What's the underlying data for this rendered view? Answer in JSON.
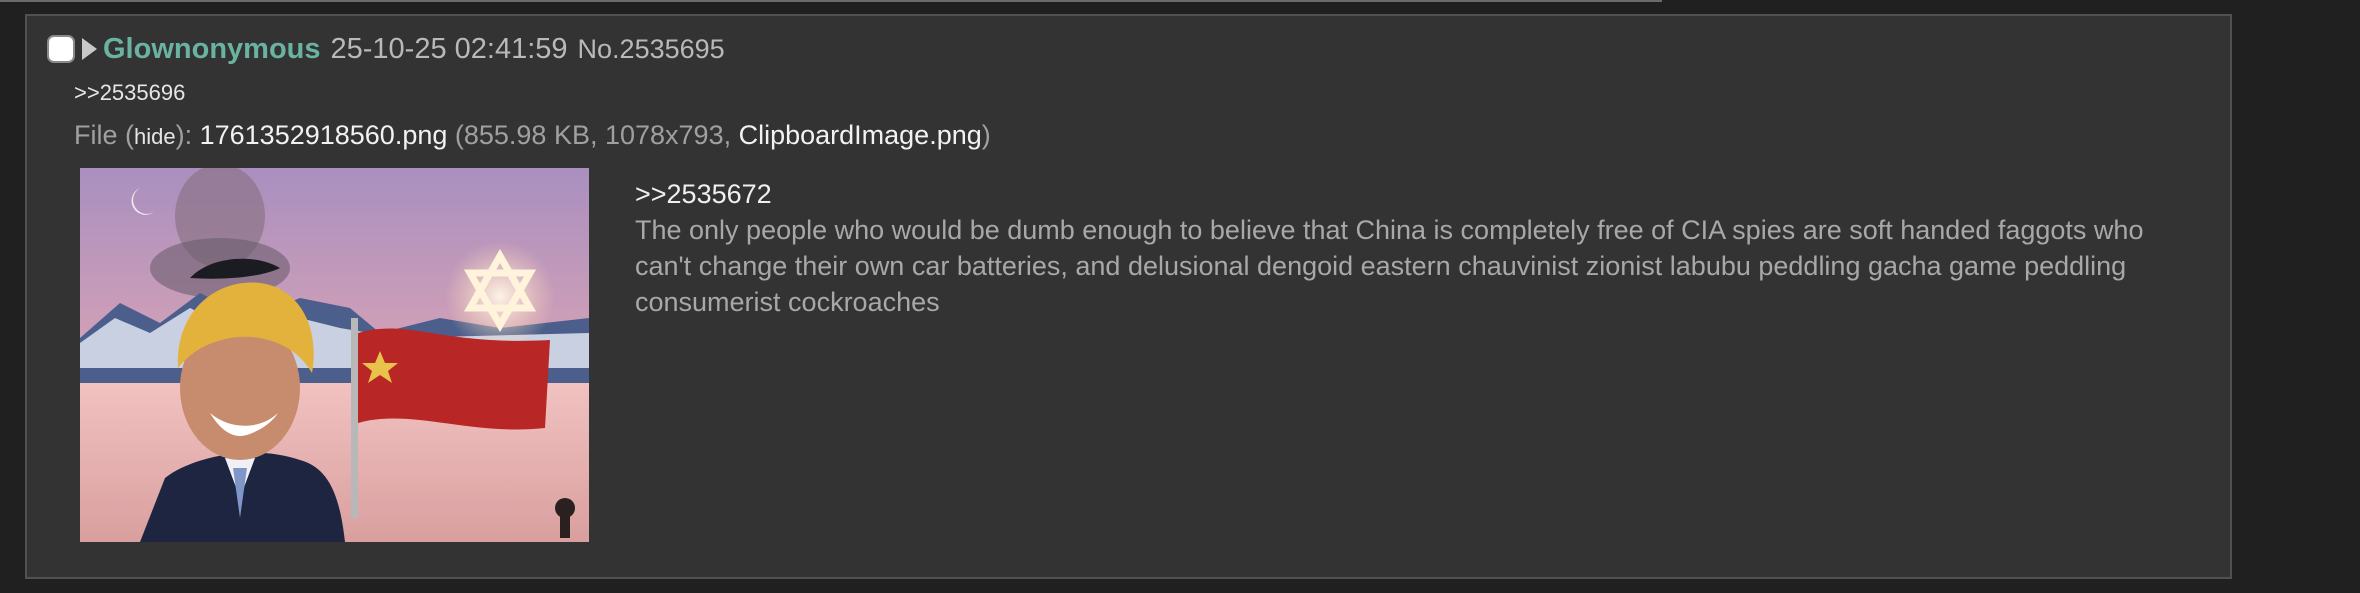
{
  "post": {
    "poster_name": "Glownonymous",
    "date": "25-10-25 02:41:59",
    "number": "No.2535695",
    "backlink": ">>2535696",
    "file": {
      "label": "File",
      "hide_open": " (",
      "hide_label": "hide",
      "hide_close": "): ",
      "filename": "1761352918560.png",
      "meta_open": " (855.98 KB, 1078x793, ",
      "original_name": "ClipboardImage.png",
      "meta_close": ")"
    },
    "quote_link": ">>2535672",
    "body_text": "The only people who would be dumb enough to believe that China is completely free of CIA spies are soft handed faggots who can't change their own car batteries, and delusional dengoid eastern chauvinist zionist labubu peddling gacha game peddling consumerist cockroaches"
  },
  "colors": {
    "page_bg": "#202020",
    "post_bg": "#333333",
    "name": "#6bb3a1",
    "text": "#b9b9b9"
  },
  "icons": {
    "select": "checkbox",
    "expand": "triangle-right-icon"
  }
}
